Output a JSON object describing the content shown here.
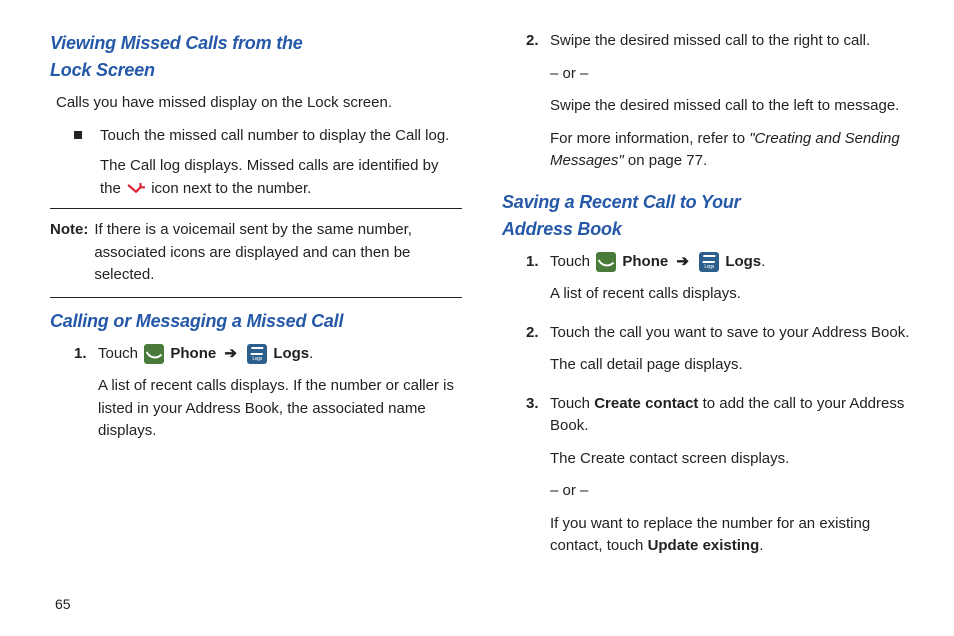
{
  "left": {
    "h1_line1": "Viewing Missed Calls from the",
    "h1_line2": "Lock Screen",
    "p1": "Calls you have missed display on the Lock screen.",
    "b1": "Touch the missed call number to display the Call log.",
    "b1_sub_a": "The Call log displays. Missed calls are identified by the ",
    "b1_sub_b": " icon next to the number.",
    "note_label": "Note:",
    "note": "If there is a voicemail sent by the same number, associated icons are displayed and can then be selected.",
    "h2": "Calling or Messaging a Missed Call",
    "s1_num": "1.",
    "s1_touch": "Touch ",
    "s1_phone": " Phone",
    "s1_arrow": " ➔ ",
    "s1_logs": " Logs",
    "s1_period": ".",
    "s1_p2": "A list of recent calls displays. If the number or caller is listed in your Address Book, the associated name displays."
  },
  "right": {
    "s2_num": "2.",
    "s2_p1": "Swipe the desired missed call to the right to call.",
    "s2_or": "– or –",
    "s2_p2": "Swipe the desired missed call to the left to message.",
    "s2_p3a": "For more information, refer to ",
    "s2_p3b": "\"Creating and Sending Messages\"",
    "s2_p3c": " on page 77.",
    "h3_line1": "Saving a Recent Call to Your",
    "h3_line2": "Address Book",
    "t1_num": "1.",
    "t1_touch": "Touch ",
    "t1_phone": " Phone",
    "t1_arrow": " ➔ ",
    "t1_logs": " Logs",
    "t1_period": ".",
    "t1_p2": "A list of recent calls displays.",
    "t2_num": "2.",
    "t2_p1": "Touch the call you want to save to your Address Book.",
    "t2_p2": "The call detail page displays.",
    "t3_num": "3.",
    "t3_a": "Touch ",
    "t3_b": "Create contact",
    "t3_c": " to add the call to your Address Book.",
    "t3_p2": "The Create contact screen displays.",
    "t3_or": "– or –",
    "t3_p3a": "If you want to replace the number for an existing contact, touch ",
    "t3_p3b": "Update existing",
    "t3_p3c": "."
  },
  "page": "65"
}
